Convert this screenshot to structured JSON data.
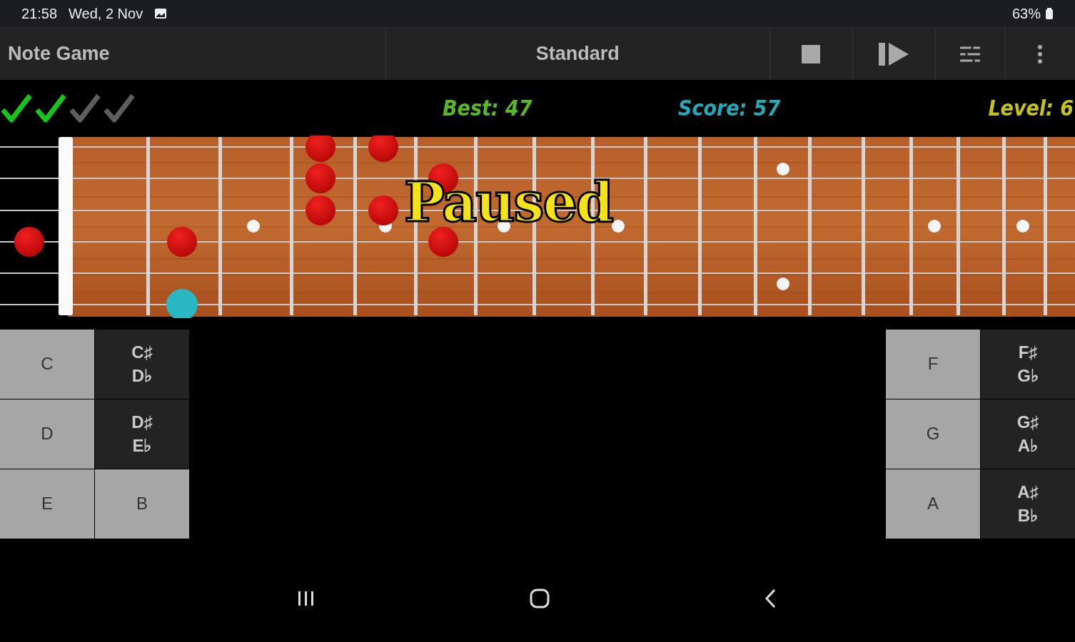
{
  "status_bar": {
    "time": "21:58",
    "date": "Wed, 2 Nov",
    "battery": "63%"
  },
  "toolbar": {
    "title": "Note Game",
    "tuning": "Standard"
  },
  "progress": [
    {
      "checked": true
    },
    {
      "checked": true
    },
    {
      "checked": false
    },
    {
      "checked": false
    }
  ],
  "scores": [
    {
      "kind": "best",
      "text": "Best: 47"
    },
    {
      "kind": "score",
      "text": "Score: 57"
    },
    {
      "kind": "level",
      "text": "Level: 6"
    }
  ],
  "overlay": "Paused",
  "left_keys": [
    {
      "kind": "natural",
      "lines": [
        "C"
      ]
    },
    {
      "kind": "natural",
      "lines": [
        "D"
      ]
    },
    {
      "kind": "natural",
      "lines": [
        "E"
      ]
    },
    {
      "kind": "accidental",
      "lines": [
        "C♯",
        "D♭"
      ]
    },
    {
      "kind": "accidental",
      "lines": [
        "D♯",
        "E♭"
      ]
    },
    {
      "kind": "natural",
      "lines": [
        "B"
      ]
    }
  ],
  "right_keys": [
    {
      "kind": "natural",
      "lines": [
        "F"
      ]
    },
    {
      "kind": "natural",
      "lines": [
        "G"
      ]
    },
    {
      "kind": "natural",
      "lines": [
        "A"
      ]
    },
    {
      "kind": "accidental",
      "lines": [
        "F♯",
        "G♭"
      ]
    },
    {
      "kind": "accidental",
      "lines": [
        "G♯",
        "A♭"
      ]
    },
    {
      "kind": "accidental",
      "lines": [
        "A♯",
        "B♭"
      ]
    }
  ]
}
